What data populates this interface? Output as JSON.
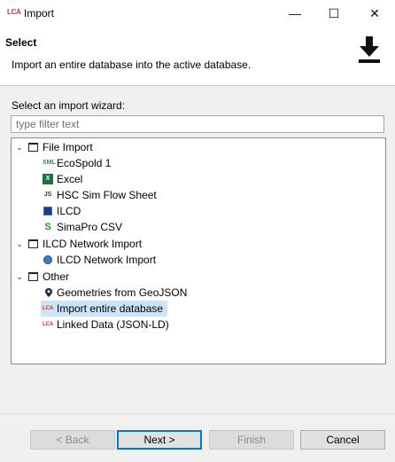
{
  "window": {
    "title": "Import",
    "app_icon": "lca-icon",
    "minimize": "—",
    "maximize": "☐",
    "close": "✕"
  },
  "header": {
    "title": "Select",
    "description": "Import an entire database into the active database.",
    "icon": "download-icon"
  },
  "wizard": {
    "label": "Select an import wizard:",
    "filter_placeholder": "type filter text"
  },
  "tree": {
    "groups": [
      {
        "label": "File Import",
        "expanded": true,
        "items": [
          {
            "label": "EcoSpold 1",
            "icon": "xml-icon",
            "icon_text": "XML"
          },
          {
            "label": "Excel",
            "icon": "excel-icon",
            "icon_text": "X"
          },
          {
            "label": "HSC Sim Flow Sheet",
            "icon": "js-icon",
            "icon_text": "JS"
          },
          {
            "label": "ILCD",
            "icon": "ilcd-icon",
            "icon_text": ""
          },
          {
            "label": "SimaPro CSV",
            "icon": "simapro-icon",
            "icon_text": "S"
          }
        ]
      },
      {
        "label": "ILCD Network Import",
        "expanded": true,
        "items": [
          {
            "label": "ILCD Network Import",
            "icon": "globe-icon",
            "icon_text": ""
          }
        ]
      },
      {
        "label": "Other",
        "expanded": true,
        "items": [
          {
            "label": "Geometries from GeoJSON",
            "icon": "map-pin-icon",
            "icon_text": ""
          },
          {
            "label": "Import entire database",
            "icon": "lca-icon",
            "icon_text": "LCA",
            "selected": true
          },
          {
            "label": "Linked Data (JSON-LD)",
            "icon": "lca-icon",
            "icon_text": "LCA"
          }
        ]
      }
    ]
  },
  "buttons": {
    "back": "< Back",
    "next": "Next >",
    "finish": "Finish",
    "cancel": "Cancel"
  },
  "colors": {
    "selection": "#cce4f7",
    "accent": "#0078d7",
    "excel": "#1e7145",
    "simapro": "#2e8b2e",
    "lca": "#c0392b"
  }
}
